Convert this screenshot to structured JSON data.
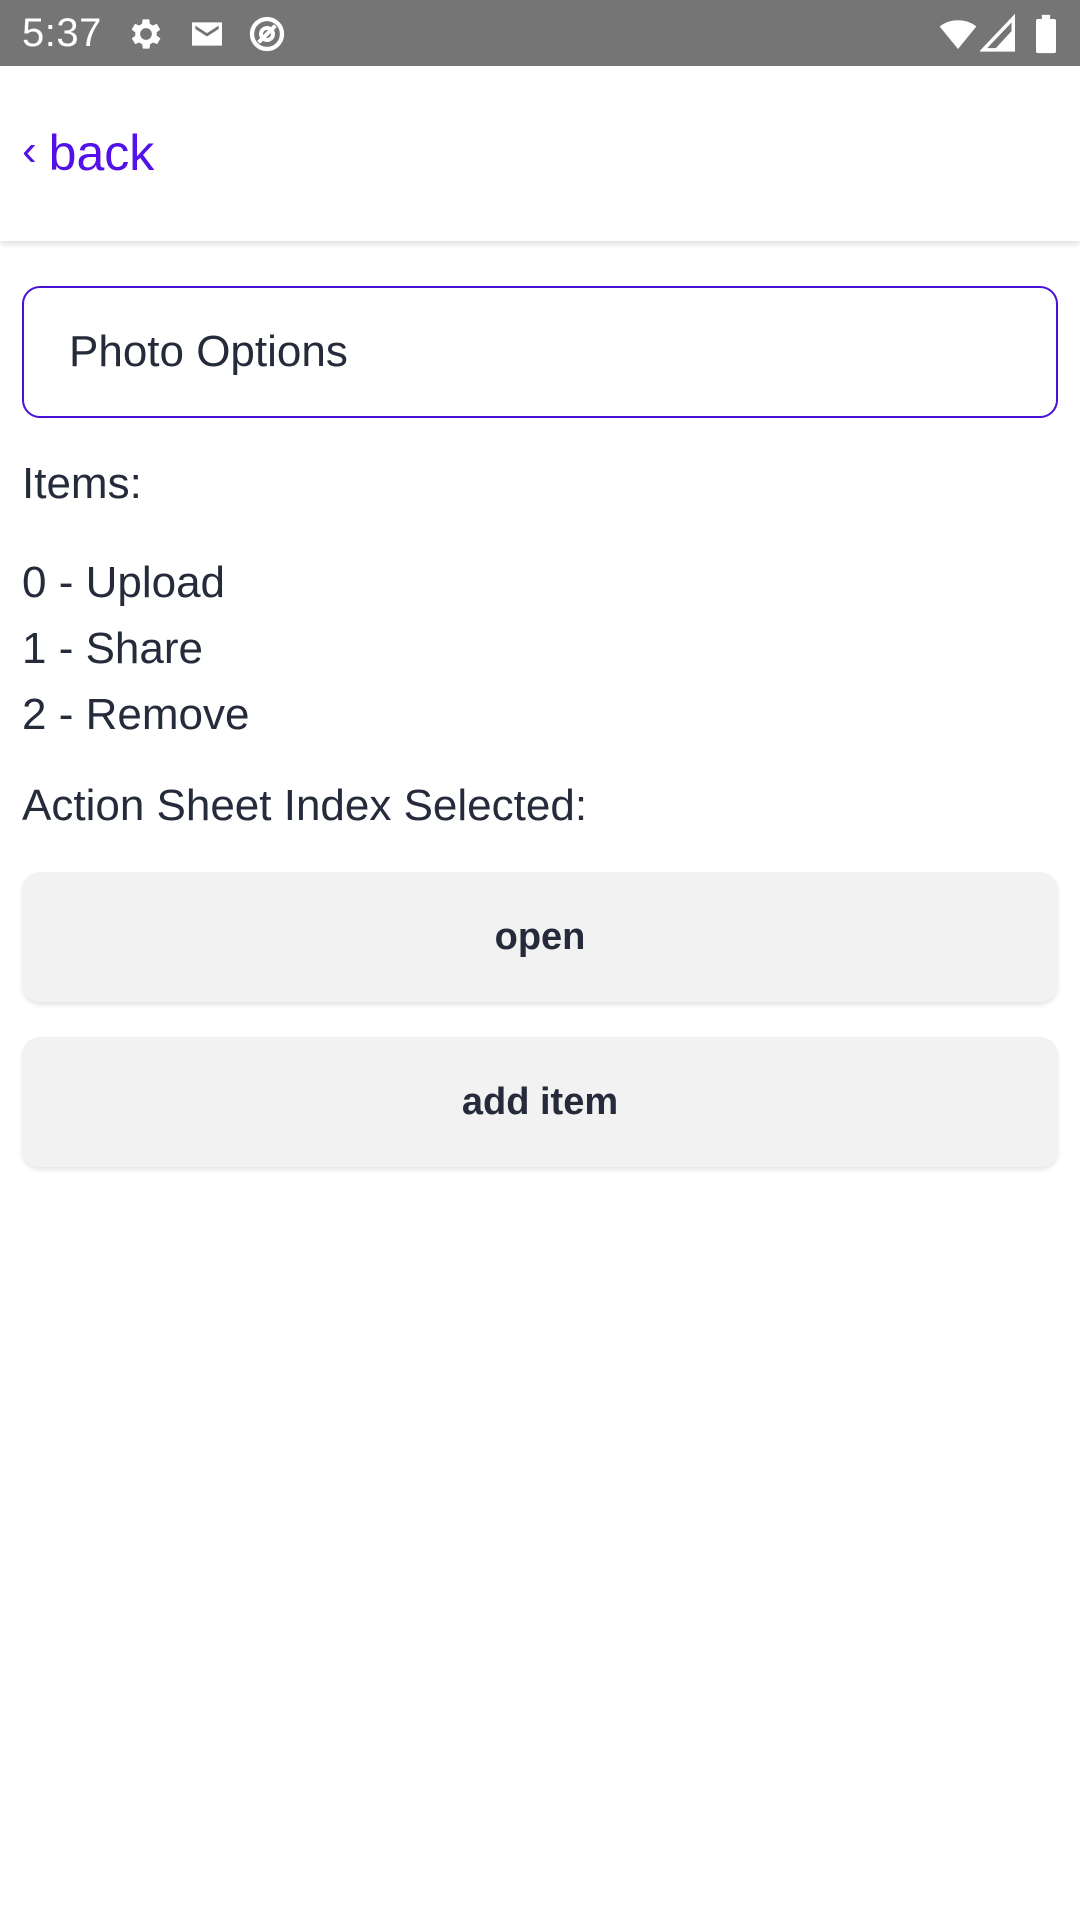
{
  "status_bar": {
    "time": "5:37",
    "left_icons": [
      "gear-icon",
      "mail-icon",
      "at-sign-icon"
    ],
    "right_icons": [
      "wifi-icon",
      "signal-icon",
      "battery-icon"
    ]
  },
  "header": {
    "back_chevron": "‹",
    "back_label": "back",
    "accent_color": "#5310e8"
  },
  "main": {
    "title_input": {
      "value": "Photo Options"
    },
    "items_label": "Items:",
    "items": [
      "0 - Upload",
      "1 - Share",
      "2 - Remove"
    ],
    "selected_label": "Action Sheet Index Selected:",
    "open_button_label": "open",
    "add_item_button_label": "add item"
  }
}
